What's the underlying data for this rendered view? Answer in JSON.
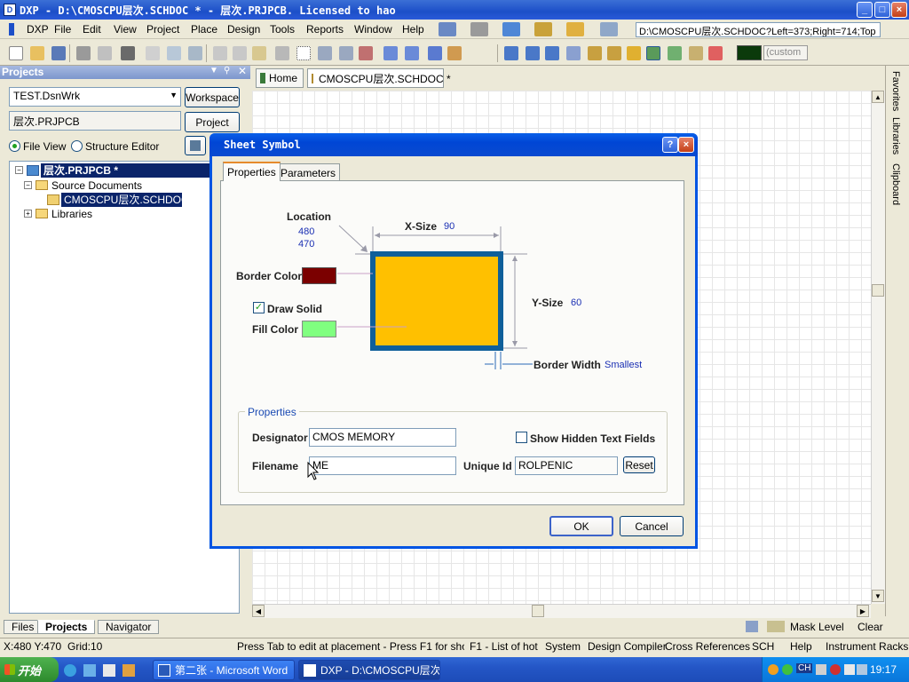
{
  "window": {
    "title": "DXP - D:\\CMOSCPU层次.SCHDOC * - 层次.PRJPCB. Licensed to hao"
  },
  "menu": {
    "items": [
      "DXP",
      "File",
      "Edit",
      "View",
      "Project",
      "Place",
      "Design",
      "Tools",
      "Reports",
      "Window",
      "Help"
    ]
  },
  "toolbar": {
    "path": "D:\\CMOSCPU层次.SCHDOC?Left=373;Right=714;Top",
    "custom_label": "(custom"
  },
  "projects_panel": {
    "header": "Projects",
    "workspace_combo": "TEST.DsnWrk",
    "workspace_button": "Workspace",
    "project_field": "层次.PRJPCB",
    "project_button": "Project",
    "file_view_label": "File View",
    "structure_editor_label": "Structure Editor",
    "tree": {
      "project": "层次.PRJPCB *",
      "source_documents": "Source Documents",
      "document": "CMOSCPU层次.SCHDOC *",
      "libraries": "Libraries"
    },
    "tabs": [
      "Files",
      "Projects",
      "Navigator"
    ]
  },
  "doc_tabs": {
    "home": "Home",
    "document": "CMOSCPU层次.SCHDOC *"
  },
  "right_dock": {
    "tabs": [
      "Favorites",
      "Libraries",
      "Clipboard"
    ]
  },
  "canvas_status": {
    "mask_level": "Mask Level",
    "clear": "Clear"
  },
  "dialog": {
    "title": "Sheet Symbol",
    "tabs": [
      "Properties",
      "Parameters"
    ],
    "location_label": "Location",
    "location_x": "480",
    "location_y": "470",
    "xsize_label": "X-Size",
    "xsize_value": "90",
    "ysize_label": "Y-Size",
    "ysize_value": "60",
    "border_color_label": "Border Color",
    "draw_solid_label": "Draw Solid",
    "fill_color_label": "Fill Color",
    "border_width_label": "Border Width",
    "border_width_value": "Smallest",
    "properties_group": "Properties",
    "designator_label": "Designator",
    "designator_value": "CMOS MEMORY",
    "show_hidden_label": "Show Hidden Text Fields",
    "filename_label": "Filename",
    "filename_value": "ME",
    "unique_id_label": "Unique Id",
    "unique_id_value": "ROLPENIC",
    "reset_button": "Reset",
    "ok_button": "OK",
    "cancel_button": "Cancel",
    "colors": {
      "border": "#7b0000",
      "fill": "#80ff80",
      "symbol_fill": "#ffc000",
      "symbol_border": "#0f5f9a"
    }
  },
  "statusbar": {
    "coords": "X:480 Y:470",
    "grid": "Grid:10",
    "hint": "Press Tab to edit at placement - Press F1 for shortcuts",
    "hotkeys": "F1 - List of hot k",
    "panels": [
      "System",
      "Design Compiler",
      "Cross References",
      "SCH",
      "Help",
      "Instrument Racks"
    ]
  },
  "taskbar": {
    "start": "开始",
    "tasks": [
      "第二张 - Microsoft Word",
      "DXP - D:\\CMOSCPU层次...."
    ],
    "tray_lang": "CH",
    "clock": "19:17"
  }
}
